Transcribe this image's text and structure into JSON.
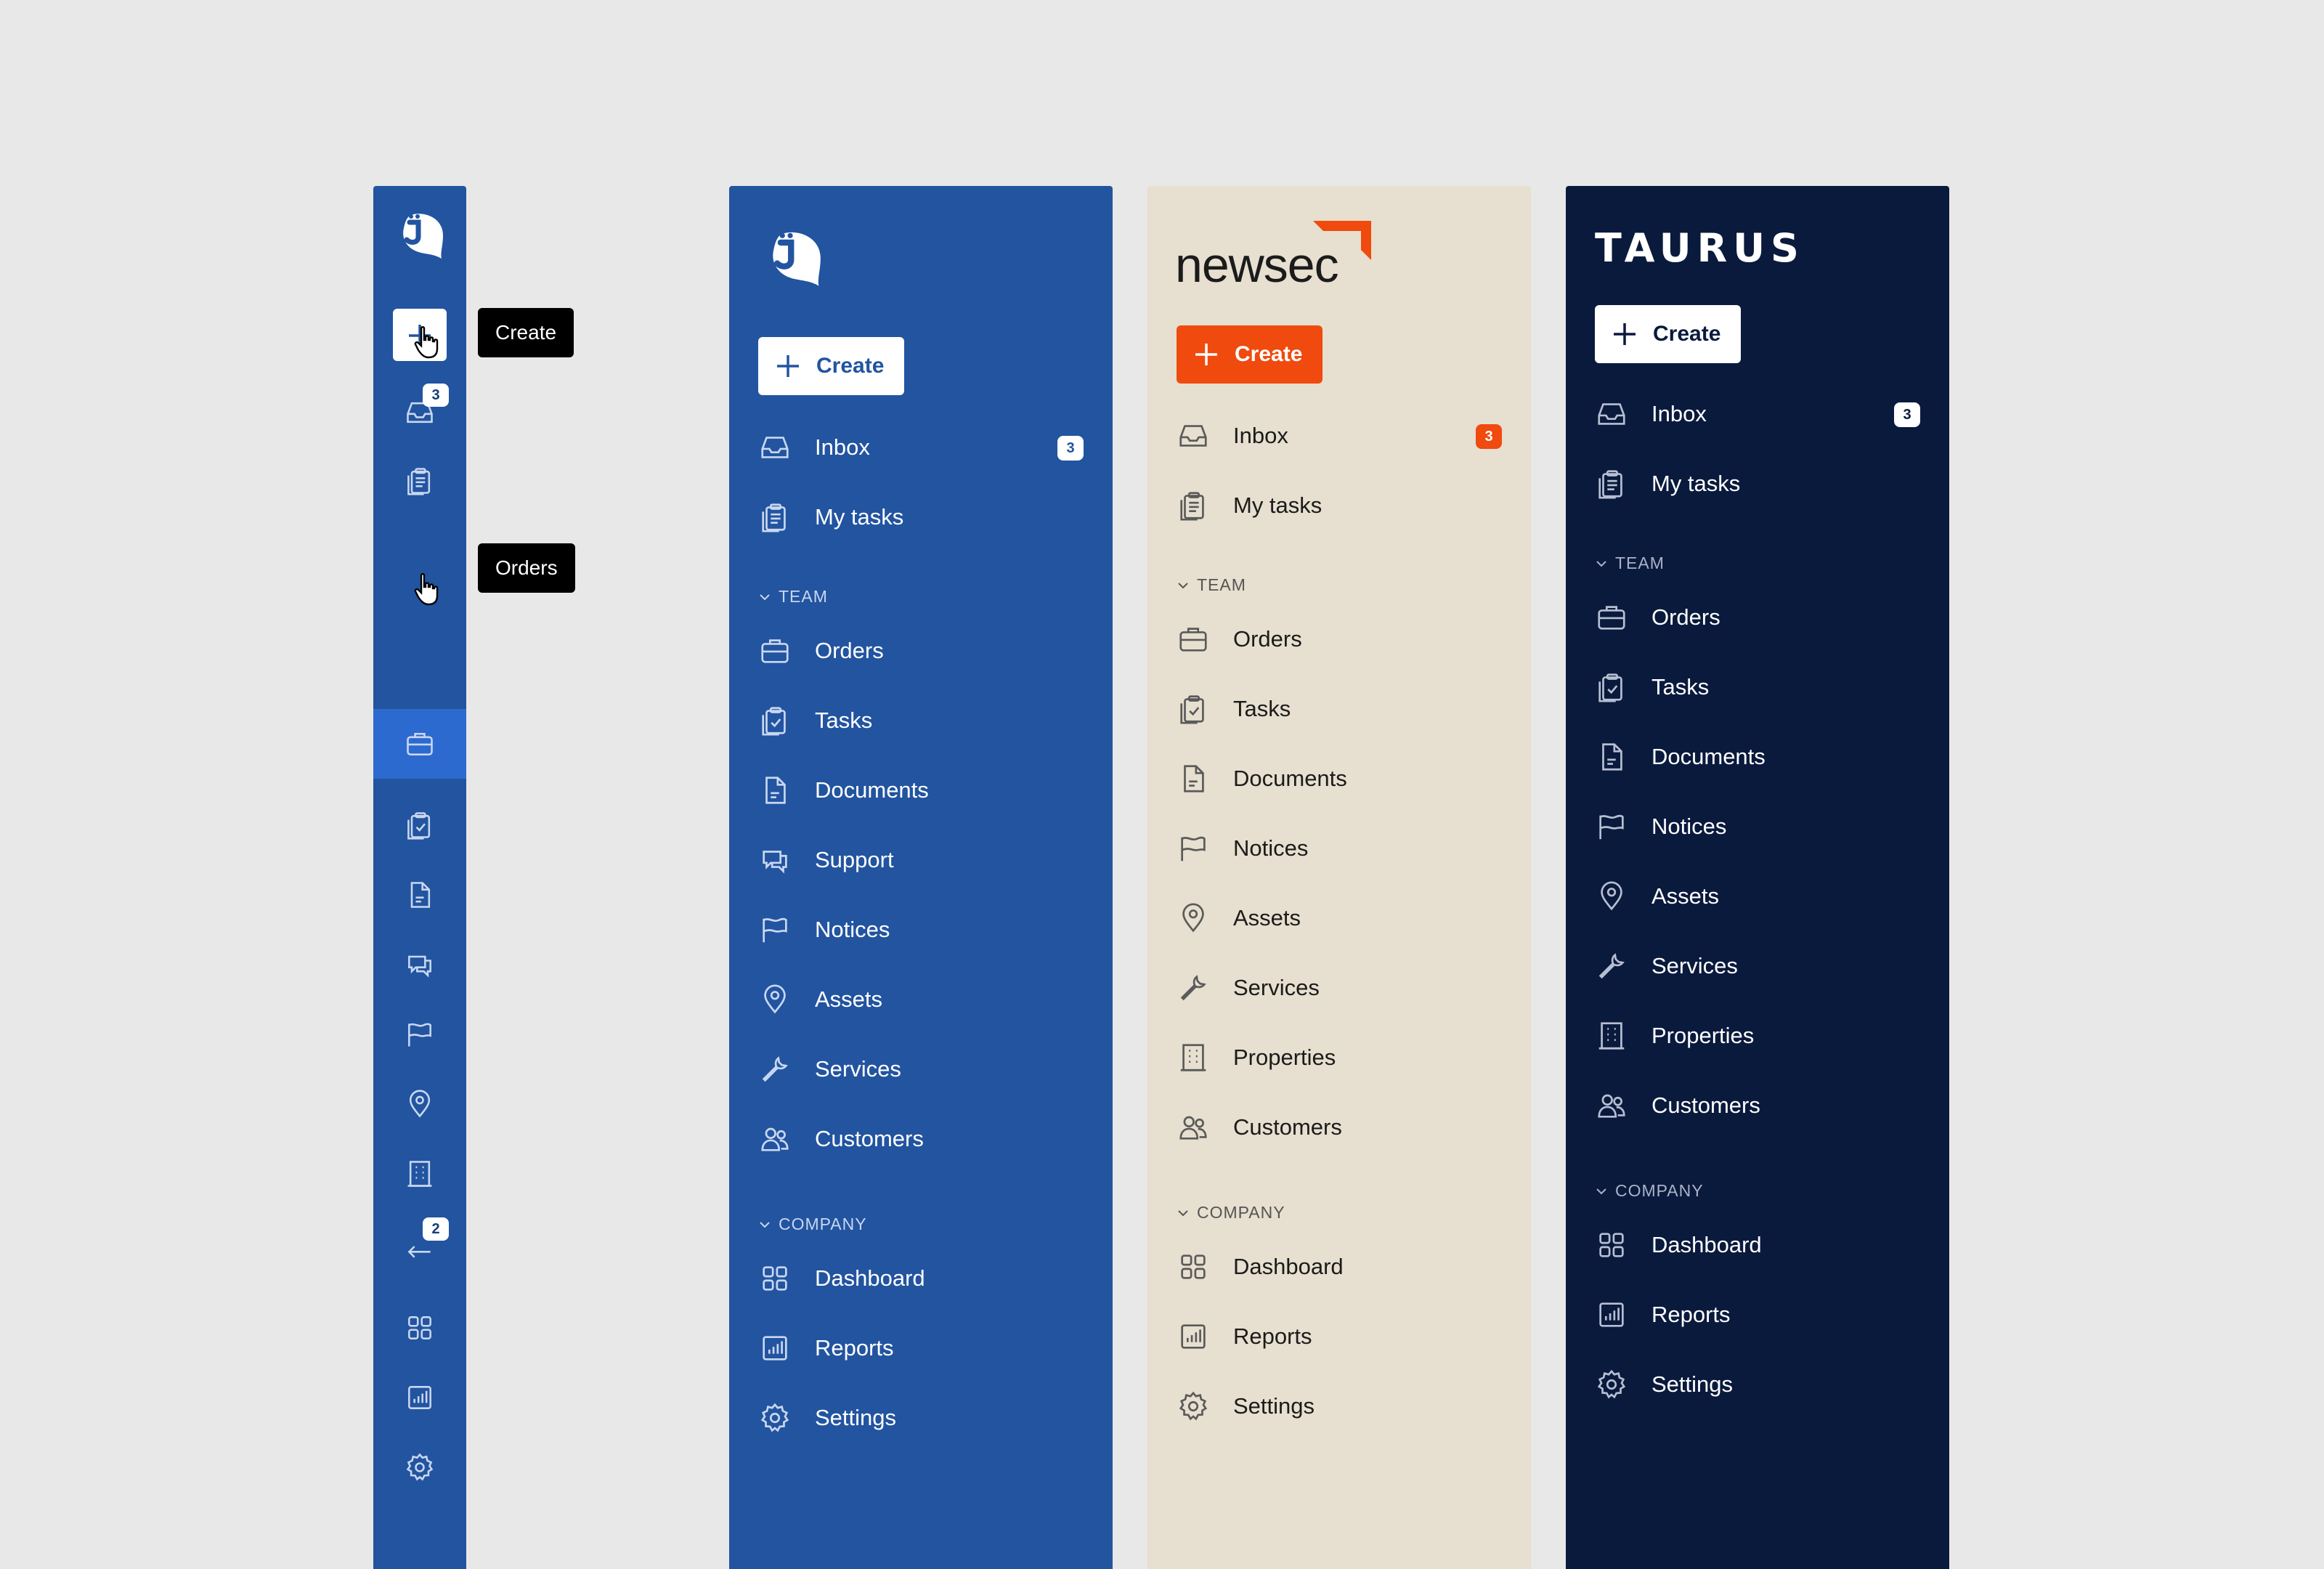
{
  "colors": {
    "background": "#e8e8e8",
    "blue_panel": "#2254a0",
    "newsec_panel": "#e7dfcf",
    "newsec_accent": "#f04a0e",
    "taurus_panel": "#0a1a3d"
  },
  "rail": {
    "logo": "jira-like-chat-logo",
    "create_icon": "plus-icon",
    "items": [
      {
        "icon": "inbox-icon",
        "badge": "3"
      },
      {
        "icon": "clipboard-icon"
      },
      {
        "icon": "briefcase-icon",
        "hovered": true
      },
      {
        "icon": "clipboard-check-icon"
      },
      {
        "icon": "document-icon"
      },
      {
        "icon": "chat-icon"
      },
      {
        "icon": "flag-icon"
      },
      {
        "icon": "location-pin-icon"
      },
      {
        "icon": "building-icon"
      },
      {
        "icon": "transfer-icon",
        "badge": "2"
      },
      {
        "icon": "grid-icon"
      },
      {
        "icon": "chart-icon"
      },
      {
        "icon": "gear-icon"
      }
    ],
    "tooltips": {
      "create": "Create",
      "orders": "Orders"
    }
  },
  "panel_blue": {
    "create_label": "Create",
    "inbox": "Inbox",
    "inbox_badge": "3",
    "my_tasks": "My tasks",
    "team_label": "TEAM",
    "team_items": [
      "Orders",
      "Tasks",
      "Documents",
      "Support",
      "Notices",
      "Assets",
      "Services",
      "Customers"
    ],
    "company_label": "COMPANY",
    "company_items": [
      "Dashboard",
      "Reports",
      "Settings"
    ]
  },
  "panel_newsec": {
    "brand": "newsec",
    "create_label": "Create",
    "inbox": "Inbox",
    "inbox_badge": "3",
    "my_tasks": "My tasks",
    "team_label": "TEAM",
    "team_items": [
      "Orders",
      "Tasks",
      "Documents",
      "Notices",
      "Assets",
      "Services",
      "Properties",
      "Customers"
    ],
    "company_label": "COMPANY",
    "company_items": [
      "Dashboard",
      "Reports",
      "Settings"
    ]
  },
  "panel_taurus": {
    "brand": "TAURUS",
    "create_label": "Create",
    "inbox": "Inbox",
    "inbox_badge": "3",
    "my_tasks": "My tasks",
    "team_label": "TEAM",
    "team_items": [
      "Orders",
      "Tasks",
      "Documents",
      "Notices",
      "Assets",
      "Services",
      "Properties",
      "Customers"
    ],
    "company_label": "COMPANY",
    "company_items": [
      "Dashboard",
      "Reports",
      "Settings"
    ]
  }
}
